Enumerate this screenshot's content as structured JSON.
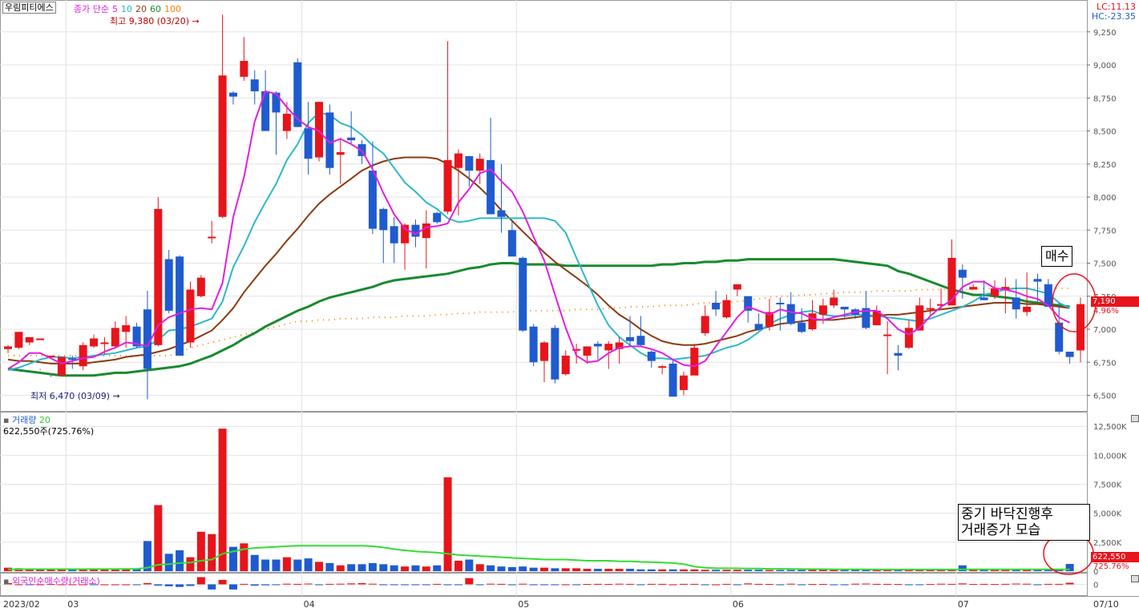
{
  "header": {
    "stock_name": "우림피티에스",
    "ma_label": "종가 단순",
    "ma_periods": [
      {
        "label": "5",
        "color": "#e020e0"
      },
      {
        "label": "10",
        "color": "#2db8c8"
      },
      {
        "label": "20",
        "color": "#8b3a0f"
      },
      {
        "label": "60",
        "color": "#1a8a30"
      },
      {
        "label": "100",
        "color": "#ff8000"
      }
    ],
    "lc": "LC:11.13",
    "hc": "HC:-23.35"
  },
  "annotations": {
    "high": "최고 9,380 (03/20)",
    "low": "최저 6,470 (03/09)",
    "buy_note": "매수",
    "volume_note_line1": "중기  바닥진행후",
    "volume_note_line2": "거래증가  모습",
    "current_price": "7,190",
    "current_change": "4.96%",
    "current_volume": "622,550",
    "current_volume_ratio": "725.76%"
  },
  "volume_panel": {
    "title": "거래량",
    "ma": "20",
    "readout": "622,550주(725.76%)"
  },
  "foreign_panel": {
    "title": "외국인순매수량(거래소)"
  },
  "colors": {
    "up": "#e8141b",
    "down": "#1f5bd0",
    "ma5": "#e020e0",
    "ma10": "#2db8c8",
    "ma20": "#8b3a0f",
    "ma60": "#1a8a30",
    "ma100": "#ff8000",
    "vol_ma": "#33dd33"
  },
  "chart_data": {
    "type": "candlestick",
    "price_axis": {
      "ticks": [
        "9,250",
        "9,000",
        "8,750",
        "8,500",
        "8,250",
        "8,000",
        "7,750",
        "7,500",
        "7,250",
        "7,000",
        "6,750",
        "6,500"
      ],
      "range": [
        6400,
        9400
      ]
    },
    "volume_axis": {
      "ticks": [
        "12,500K",
        "10,000K",
        "7,500K",
        "5,000K",
        "2,500K",
        "0"
      ],
      "range": [
        0,
        13000
      ]
    },
    "foreign_axis": {
      "ticks": [
        "0"
      ]
    },
    "x_labels": [
      {
        "label": "2023/02",
        "index": 0
      },
      {
        "label": "03",
        "index": 6
      },
      {
        "label": "04",
        "index": 28
      },
      {
        "label": "05",
        "index": 48
      },
      {
        "label": "06",
        "index": 68
      },
      {
        "label": "07",
        "index": 89
      },
      {
        "label": "07/10",
        "index": 96
      }
    ],
    "candles": [
      [
        6850,
        6870,
        6820,
        6880
      ],
      [
        6860,
        6980,
        6850,
        6920
      ],
      [
        6900,
        6940,
        6880,
        6910
      ],
      [
        6920,
        6930,
        6690,
        6700
      ],
      [
        6790,
        6800,
        6640,
        6650
      ],
      [
        6650,
        6790,
        6650,
        6780
      ],
      [
        6780,
        6770,
        6700,
        6800
      ],
      [
        6720,
        6880,
        6690,
        6900
      ],
      [
        6870,
        6930,
        6860,
        6960
      ],
      [
        6900,
        6900,
        6810,
        6940
      ],
      [
        6870,
        7010,
        6860,
        7060
      ],
      [
        6980,
        7030,
        6860,
        7100
      ],
      [
        7020,
        6870,
        6860,
        7050
      ],
      [
        7150,
        6700,
        6470,
        7290
      ],
      [
        6880,
        7910,
        6870,
        8000
      ],
      [
        7530,
        7140,
        7120,
        7600
      ],
      [
        7550,
        6800,
        6800,
        7560
      ],
      [
        6900,
        7300,
        6860,
        7360
      ],
      [
        7250,
        7390,
        7240,
        7410
      ],
      [
        7700,
        7700,
        7650,
        7820
      ],
      [
        7850,
        8920,
        7840,
        9380
      ],
      [
        8790,
        8760,
        8700,
        8800
      ],
      [
        8910,
        9030,
        8880,
        9210
      ],
      [
        8890,
        8800,
        8700,
        8960
      ],
      [
        8800,
        8500,
        8500,
        8960
      ],
      [
        8790,
        8640,
        8320,
        8800
      ],
      [
        8500,
        8630,
        8440,
        8720
      ],
      [
        9020,
        8530,
        8530,
        9050
      ],
      [
        8520,
        8290,
        8170,
        8720
      ],
      [
        8300,
        8720,
        8270,
        8720
      ],
      [
        8640,
        8220,
        8170,
        8700
      ],
      [
        8320,
        8340,
        8100,
        8450
      ],
      [
        8450,
        8430,
        8400,
        8650
      ],
      [
        8400,
        8310,
        8250,
        8430
      ],
      [
        8200,
        7760,
        7720,
        8420
      ],
      [
        7910,
        7750,
        7500,
        7920
      ],
      [
        7780,
        7650,
        7500,
        7850
      ],
      [
        7650,
        7790,
        7450,
        7800
      ],
      [
        7790,
        7700,
        7620,
        7830
      ],
      [
        7690,
        7800,
        7460,
        7900
      ],
      [
        7880,
        7810,
        7800,
        7890
      ],
      [
        7890,
        8280,
        7870,
        9180
      ],
      [
        8220,
        8330,
        7860,
        8360
      ],
      [
        8310,
        8200,
        8080,
        8310
      ],
      [
        8200,
        8290,
        8100,
        8330
      ],
      [
        8280,
        7870,
        7870,
        8600
      ],
      [
        7900,
        7850,
        7730,
        8250
      ],
      [
        7750,
        7550,
        7560,
        7820
      ],
      [
        7540,
        6990,
        6980,
        7550
      ],
      [
        7020,
        6750,
        6720,
        7040
      ],
      [
        6760,
        6900,
        6600,
        6910
      ],
      [
        7010,
        6620,
        6590,
        7030
      ],
      [
        6660,
        6800,
        6650,
        6840
      ],
      [
        6850,
        6850,
        6740,
        6890
      ],
      [
        6800,
        6870,
        6740,
        6850
      ],
      [
        6890,
        6870,
        6770,
        6910
      ],
      [
        6840,
        6890,
        6700,
        6910
      ],
      [
        6850,
        6900,
        6740,
        6940
      ],
      [
        6940,
        6910,
        6870,
        7100
      ],
      [
        6950,
        6880,
        6870,
        7100
      ],
      [
        6830,
        6760,
        6710,
        6840
      ],
      [
        6720,
        6720,
        6660,
        6730
      ],
      [
        6740,
        6490,
        6490,
        6770
      ],
      [
        6540,
        6650,
        6500,
        6680
      ],
      [
        6650,
        6860,
        6660,
        6890
      ],
      [
        6970,
        7100,
        6950,
        7180
      ],
      [
        7200,
        7150,
        7100,
        7290
      ],
      [
        7090,
        7220,
        7080,
        7260
      ],
      [
        7300,
        7340,
        7250,
        7330
      ],
      [
        7250,
        7140,
        7050,
        7240
      ],
      [
        7040,
        7000,
        6990,
        7120
      ],
      [
        7020,
        7130,
        6990,
        7230
      ],
      [
        7200,
        7190,
        6990,
        7240
      ],
      [
        7190,
        7040,
        7030,
        7280
      ],
      [
        7050,
        6980,
        6970,
        7160
      ],
      [
        7000,
        7120,
        6990,
        7220
      ],
      [
        7110,
        7180,
        7040,
        7230
      ],
      [
        7180,
        7240,
        7160,
        7300
      ],
      [
        7170,
        7150,
        7090,
        7160
      ],
      [
        7150,
        7110,
        7080,
        7160
      ],
      [
        7160,
        7010,
        7000,
        7290
      ],
      [
        7030,
        7140,
        7030,
        7180
      ],
      [
        6950,
        6960,
        6660,
        7060
      ],
      [
        6820,
        6800,
        6690,
        6880
      ],
      [
        6860,
        7010,
        6850,
        7070
      ],
      [
        6990,
        7180,
        7000,
        7240
      ],
      [
        7160,
        7160,
        7110,
        7230
      ],
      [
        7180,
        7190,
        7150,
        7310
      ],
      [
        7180,
        7540,
        7200,
        7680
      ],
      [
        7450,
        7390,
        7230,
        7490
      ],
      [
        7300,
        7320,
        7300,
        7340
      ],
      [
        7240,
        7220,
        7220,
        7370
      ],
      [
        7250,
        7310,
        7230,
        7370
      ],
      [
        7300,
        7320,
        7120,
        7390
      ],
      [
        7240,
        7150,
        7080,
        7380
      ],
      [
        7130,
        7170,
        7100,
        7430
      ],
      [
        7380,
        7360,
        7210,
        7420
      ],
      [
        7340,
        7170,
        7170,
        7380
      ],
      [
        7050,
        6830,
        6810,
        7200
      ],
      [
        6830,
        6790,
        6740,
        6820
      ],
      [
        6840,
        7190,
        6750,
        7240
      ]
    ],
    "ma5": [
      6700,
      6750,
      6820,
      6820,
      6780,
      6740,
      6760,
      6780,
      6790,
      6830,
      6860,
      6900,
      6890,
      6870,
      7030,
      7090,
      7120,
      7150,
      7160,
      7150,
      7350,
      7850,
      8150,
      8570,
      8800,
      8780,
      8680,
      8590,
      8530,
      8500,
      8410,
      8440,
      8400,
      8350,
      8210,
      8030,
      7870,
      7760,
      7720,
      7770,
      7780,
      7800,
      7960,
      8060,
      8180,
      8210,
      8120,
      8040,
      7890,
      7700,
      7520,
      7260,
      7010,
      6800,
      6750,
      6760,
      6820,
      6860,
      6870,
      6870,
      6850,
      6820,
      6770,
      6730,
      6720,
      6760,
      6870,
      6980,
      7090,
      7170,
      7140,
      7110,
      7150,
      7130,
      7120,
      7080,
      7070,
      7090,
      7110,
      7130,
      7140,
      7140,
      7080,
      7000,
      6960,
      7010,
      7100,
      7170,
      7220,
      7320,
      7360,
      7360,
      7310,
      7300,
      7280,
      7250,
      7230,
      7180,
      7090,
      7050
    ],
    "ma10": [
      6690,
      6710,
      6740,
      6770,
      6790,
      6790,
      6780,
      6790,
      6800,
      6810,
      6820,
      6840,
      6860,
      6870,
      6920,
      6990,
      7000,
      7020,
      7050,
      7080,
      7210,
      7470,
      7630,
      7810,
      7960,
      8100,
      8280,
      8400,
      8560,
      8640,
      8620,
      8560,
      8530,
      8470,
      8390,
      8330,
      8220,
      8110,
      8040,
      7960,
      7910,
      7840,
      7810,
      7820,
      7840,
      7840,
      7840,
      7840,
      7840,
      7840,
      7840,
      7820,
      7730,
      7540,
      7360,
      7180,
      7030,
      6940,
      6880,
      6820,
      6780,
      6780,
      6770,
      6780,
      6790,
      6800,
      6830,
      6860,
      6880,
      6920,
      6980,
      7040,
      7080,
      7110,
      7130,
      7140,
      7110,
      7100,
      7100,
      7110,
      7110,
      7100,
      7090,
      7080,
      7070,
      7060,
      7080,
      7110,
      7140,
      7170,
      7210,
      7260,
      7280,
      7300,
      7310,
      7310,
      7290,
      7270,
      7200,
      7160
    ],
    "ma20": [
      6770,
      6760,
      6760,
      6750,
      6740,
      6740,
      6740,
      6740,
      6750,
      6760,
      6770,
      6790,
      6800,
      6810,
      6830,
      6850,
      6880,
      6910,
      6950,
      6990,
      7070,
      7160,
      7280,
      7380,
      7480,
      7570,
      7670,
      7760,
      7860,
      7950,
      8020,
      8080,
      8140,
      8200,
      8240,
      8270,
      8290,
      8300,
      8300,
      8300,
      8290,
      8250,
      8200,
      8140,
      8070,
      7990,
      7900,
      7820,
      7740,
      7660,
      7580,
      7510,
      7450,
      7390,
      7330,
      7260,
      7180,
      7110,
      7060,
      7000,
      6950,
      6910,
      6890,
      6880,
      6880,
      6890,
      6910,
      6930,
      6950,
      6980,
      7000,
      7020,
      7040,
      7050,
      7060,
      7070,
      7070,
      7070,
      7080,
      7090,
      7100,
      7100,
      7110,
      7110,
      7120,
      7130,
      7140,
      7150,
      7160,
      7170,
      7180,
      7190,
      7200,
      7200,
      7200,
      7190,
      7190,
      7180,
      7170,
      7160
    ],
    "ma60": [
      6700,
      6690,
      6680,
      6670,
      6660,
      6650,
      6650,
      6650,
      6650,
      6660,
      6670,
      6670,
      6680,
      6690,
      6700,
      6710,
      6720,
      6740,
      6770,
      6800,
      6840,
      6880,
      6930,
      6970,
      7020,
      7060,
      7100,
      7140,
      7170,
      7210,
      7240,
      7260,
      7280,
      7300,
      7320,
      7350,
      7370,
      7380,
      7390,
      7400,
      7410,
      7420,
      7440,
      7460,
      7470,
      7490,
      7500,
      7500,
      7490,
      7490,
      7490,
      7490,
      7480,
      7480,
      7480,
      7480,
      7480,
      7480,
      7480,
      7480,
      7480,
      7490,
      7490,
      7500,
      7500,
      7510,
      7510,
      7520,
      7520,
      7530,
      7530,
      7530,
      7530,
      7530,
      7530,
      7530,
      7530,
      7530,
      7520,
      7510,
      7500,
      7490,
      7480,
      7440,
      7420,
      7390,
      7360,
      7330,
      7300,
      7280,
      7260,
      7260,
      7250,
      7240,
      7230,
      7210,
      7200,
      7190,
      7180,
      7170
    ],
    "ma100": [
      6800,
      6800,
      6800,
      6800,
      6800,
      6800,
      6800,
      6800,
      6800,
      6800,
      6800,
      6800,
      6800,
      6800,
      6800,
      6800,
      6820,
      6860,
      6880,
      6900,
      6920,
      6940,
      6960,
      6980,
      7000,
      7020,
      7040,
      7060,
      7060,
      7070,
      7070,
      7080,
      7080,
      7080,
      7090,
      7090,
      7090,
      7100,
      7100,
      7100,
      7110,
      7110,
      7120,
      7120,
      7130,
      7130,
      7130,
      7130,
      7140,
      7140,
      7140,
      7140,
      7140,
      7150,
      7150,
      7150,
      7160,
      7160,
      7170,
      7170,
      7170,
      7180,
      7180,
      7180,
      7190,
      7200,
      7200,
      7200,
      7210,
      7220,
      7230,
      7240,
      7250,
      7250,
      7260,
      7260,
      7270,
      7270,
      7280,
      7280,
      7280,
      7290,
      7290,
      7290,
      7290,
      7300,
      7300,
      7300,
      7300,
      7300,
      7300,
      7310,
      7310,
      7310,
      7310,
      7310,
      7310,
      7310,
      7310,
      7310
    ],
    "volume": [
      300,
      250,
      200,
      200,
      180,
      160,
      180,
      160,
      200,
      180,
      200,
      220,
      250,
      2600,
      5700,
      1500,
      1800,
      1200,
      3400,
      3200,
      12300,
      2100,
      2400,
      1400,
      1000,
      1000,
      1200,
      1000,
      1100,
      800,
      700,
      500,
      600,
      600,
      700,
      600,
      500,
      400,
      500,
      400,
      500,
      8100,
      900,
      1000,
      600,
      500,
      400,
      350,
      400,
      300,
      300,
      250,
      250,
      250,
      200,
      200,
      200,
      200,
      200,
      150,
      150,
      150,
      150,
      150,
      150,
      120,
      120,
      120,
      120,
      120,
      120,
      100,
      100,
      100,
      100,
      100,
      100,
      100,
      100,
      100,
      100,
      100,
      100,
      100,
      100,
      100,
      100,
      200,
      100,
      500,
      200,
      200,
      100,
      100,
      100,
      100,
      100,
      200,
      100,
      622
    ],
    "volume_ma": [
      150,
      160,
      170,
      170,
      170,
      170,
      170,
      170,
      180,
      180,
      180,
      190,
      200,
      300,
      550,
      600,
      700,
      750,
      900,
      1000,
      1500,
      1700,
      1900,
      2000,
      2050,
      2100,
      2150,
      2200,
      2200,
      2200,
      2200,
      2200,
      2200,
      2200,
      2150,
      2050,
      1900,
      1800,
      1700,
      1650,
      1600,
      1500,
      1400,
      1350,
      1300,
      1250,
      1200,
      1150,
      1100,
      1050,
      1000,
      1000,
      1000,
      950,
      900,
      900,
      900,
      850,
      850,
      800,
      780,
      750,
      700,
      600,
      400,
      300,
      250,
      250,
      240,
      230,
      220,
      200,
      200,
      190,
      180,
      170,
      170,
      160,
      160,
      150,
      150,
      140,
      140,
      140,
      140,
      140,
      140,
      140,
      140,
      160,
      150,
      150,
      150,
      150,
      150,
      150,
      150,
      150,
      150,
      150
    ],
    "foreign": [
      80,
      0,
      -40,
      0,
      20,
      0,
      0,
      0,
      -30,
      0,
      0,
      0,
      -30,
      80,
      -80,
      -120,
      -160,
      -100,
      450,
      -320,
      280,
      -320,
      30,
      -80,
      -60,
      -40,
      40,
      30,
      50,
      -30,
      30,
      40,
      60,
      80,
      40,
      -40,
      -30,
      -20,
      -20,
      -20,
      30,
      -10,
      -40,
      390,
      -30,
      40,
      30,
      -20,
      40,
      -20,
      -20,
      -10,
      0,
      -10,
      20,
      30,
      20,
      40,
      30,
      -30,
      30,
      30,
      0,
      30,
      30,
      -40,
      0,
      30,
      -20,
      60,
      30,
      20,
      -30,
      40,
      -20,
      20,
      20,
      -10,
      -20,
      40,
      50,
      30,
      30,
      20,
      -40,
      -30,
      20,
      40,
      30,
      60,
      20,
      30,
      20,
      30,
      50,
      40,
      -40,
      30,
      30,
      100
    ]
  }
}
